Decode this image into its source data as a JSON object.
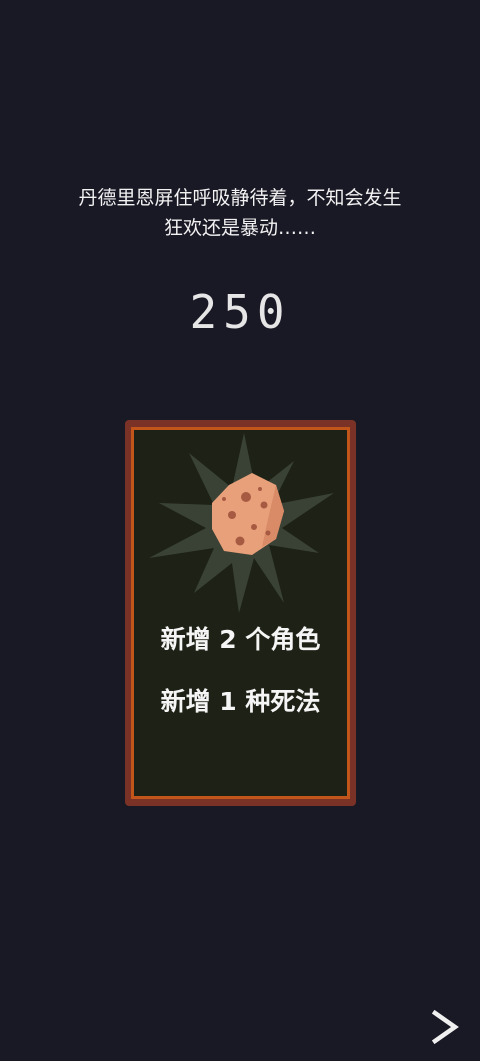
{
  "story": {
    "line1": "丹德里恩屏住呼吸静待着，不知会发生",
    "line2": "狂欢还是暴动……"
  },
  "score": "250",
  "card": {
    "art_icon": "meteor-rock-icon",
    "line1": "新增 2 个角色",
    "line2": "新增 1 种死法"
  },
  "navigation": {
    "next_icon": "chevron-right-icon"
  },
  "colors": {
    "background": "#191825",
    "card_frame": "#7a3226",
    "card_border": "#c2551a",
    "card_fill": "#1e2216",
    "rock": "#e8a07a"
  }
}
